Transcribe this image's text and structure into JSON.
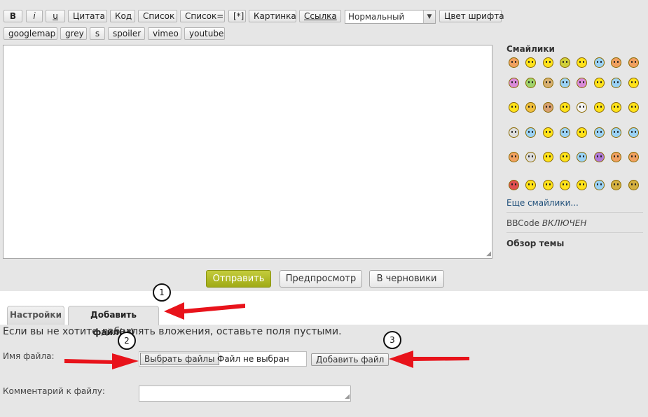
{
  "toolbar": {
    "bold": "B",
    "italic": "i",
    "underline": "u",
    "quote": "Цитата",
    "code": "Код",
    "list": "Список",
    "list_numbered": "Список=",
    "list_item": "[*]",
    "image": "Картинка",
    "link": "Ссылка",
    "size_select": "Нормальный",
    "font_color": "Цвет шрифта",
    "googlemap": "googlemap",
    "grey": "grey",
    "strike": "s",
    "spoiler": "spoiler",
    "vimeo": "vimeo",
    "youtube": "youtube"
  },
  "sidebar": {
    "smilies_title": "Смайлики",
    "more_smilies": "Еще смайлики...",
    "bbcode_prefix": "BBCode",
    "bbcode_status": "ВКЛЮЧЕН",
    "topic_review": "Обзор темы"
  },
  "actions": {
    "submit": "Отправить",
    "preview": "Предпросмотр",
    "draft": "В черновики"
  },
  "tabs": {
    "settings": "Настройки",
    "add_files": "Добавить файл(ы)"
  },
  "attachments": {
    "info": "Если вы не хотите добавлять вложения, оставьте поля пустыми.",
    "filename_label": "Имя файла:",
    "choose_files": "Выбрать файлы",
    "no_file": "Файл не выбран",
    "add_file": "Добавить файл",
    "comment_label": "Комментарий к файлу:"
  },
  "annotations": {
    "step1": "1",
    "step2": "2",
    "step3": "3"
  },
  "colors": {
    "arrow": "#e8131b",
    "submit_button": "#a8b21c",
    "page_background": "#e6e6e6"
  }
}
